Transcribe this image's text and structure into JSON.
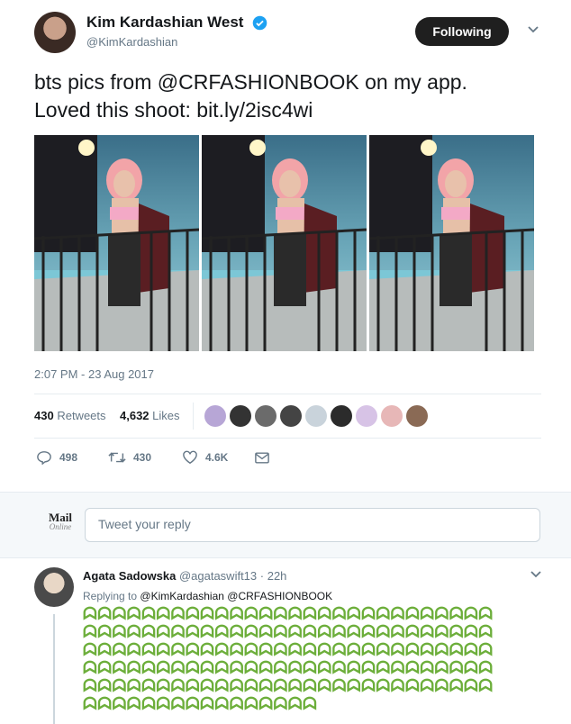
{
  "tweet": {
    "author_name": "Kim Kardashian West",
    "author_handle": "@KimKardashian",
    "follow_label": "Following",
    "text_line1": "bts pics from @CRFASHIONBOOK on my app.",
    "text_line2": "Loved this shoot: bit.ly/2isc4wi",
    "timestamp": "2:07 PM - 23 Aug 2017",
    "retweets_count": "430",
    "retweets_label": "Retweets",
    "likes_count": "4,632",
    "likes_label": "Likes",
    "reply_count": "498",
    "retweet_action_count": "430",
    "like_action_count": "4.6K"
  },
  "reply_composer": {
    "logo_text": "Mail",
    "logo_sub": "Online",
    "placeholder": "Tweet your reply"
  },
  "reply": {
    "author_name": "Agata Sadowska",
    "author_handle": "@agataswift13",
    "time": "· 22h",
    "replying_to_label": "Replying to",
    "replying_to_handles": "@KimKardashian @CRFASHIONBOOK",
    "emoji_line_1": "ᗣᗣᗣᗣᗣᗣᗣᗣᗣᗣᗣᗣᗣᗣᗣᗣᗣᗣᗣᗣᗣᗣᗣᗣᗣᗣᗣᗣ",
    "emoji_line_2": "ᗣᗣᗣᗣᗣᗣᗣᗣᗣᗣᗣᗣᗣᗣᗣᗣᗣᗣᗣᗣᗣᗣᗣᗣᗣᗣᗣᗣ",
    "emoji_line_3": "ᗣᗣᗣᗣᗣᗣᗣᗣᗣᗣᗣᗣᗣᗣᗣᗣᗣᗣᗣᗣᗣᗣᗣᗣᗣᗣᗣᗣ",
    "emoji_line_4": "ᗣᗣᗣᗣᗣᗣᗣᗣᗣᗣᗣᗣᗣᗣᗣᗣᗣᗣᗣᗣᗣᗣᗣᗣᗣᗣᗣᗣ",
    "emoji_line_5": "ᗣᗣᗣᗣᗣᗣᗣᗣᗣᗣᗣᗣᗣᗣᗣᗣᗣᗣᗣᗣᗣᗣᗣᗣᗣᗣᗣᗣ",
    "emoji_line_6": "ᗣᗣᗣᗣᗣᗣᗣᗣᗣᗣᗣᗣᗣᗣᗣᗣ"
  },
  "colors": {
    "verified": "#1da1f2",
    "emoji_green": "#6cae3a",
    "button_dark": "#1f1f1f"
  }
}
